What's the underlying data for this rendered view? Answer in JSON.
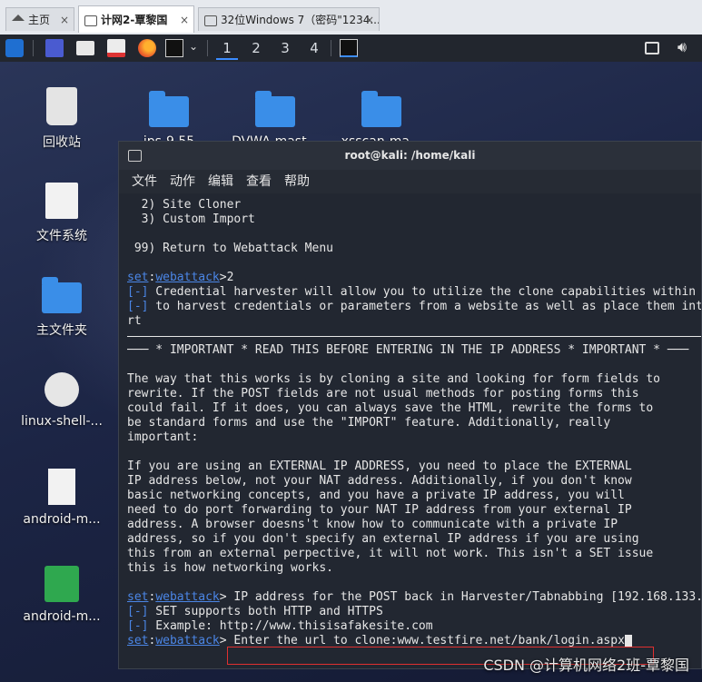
{
  "browser_tabs": [
    {
      "label": "主页",
      "close": "×"
    },
    {
      "label": "计网2-覃黎国",
      "close": "×"
    },
    {
      "label": "32位Windows 7（密码\"1234...",
      "close": "×"
    }
  ],
  "panel": {
    "workspaces": [
      "1",
      "2",
      "3",
      "4"
    ]
  },
  "desktop_icons": [
    {
      "label": "回收站"
    },
    {
      "label": "文件系统"
    },
    {
      "label": "主文件夹"
    },
    {
      "label": "linux-shell-..."
    },
    {
      "label": "android-m..."
    },
    {
      "label": "android-m..."
    },
    {
      "label": "ips-9.55"
    },
    {
      "label": "DVWA-mast..."
    },
    {
      "label": "xsscan-ma..."
    }
  ],
  "terminal": {
    "title": "root@kali: /home/kali",
    "menu": [
      "文件",
      "动作",
      "编辑",
      "查看",
      "帮助"
    ],
    "lines_top": [
      "  2) Site Cloner",
      "  3) Custom Import",
      "",
      " 99) Return to Webattack Menu",
      ""
    ],
    "prompt_set": "set",
    "prompt_module": "webattack",
    "cmd1": ">2",
    "info1_marker": "[-]",
    "info1": " Credential harvester will allow you to utilize the clone capabilities within SET",
    "info2_marker": "[-]",
    "info2": " to harvest credentials or parameters from a website as well as place them into a repo",
    "info2_cont": "rt",
    "important": "─── * IMPORTANT * READ THIS BEFORE ENTERING IN THE IP ADDRESS * IMPORTANT * ───",
    "para1": [
      "The way that this works is by cloning a site and looking for form fields to",
      "rewrite. If the POST fields are not usual methods for posting forms this",
      "could fail. If it does, you can always save the HTML, rewrite the forms to",
      "be standard forms and use the \"IMPORT\" feature. Additionally, really",
      "important:"
    ],
    "para2": [
      "If you are using an EXTERNAL IP ADDRESS, you need to place the EXTERNAL",
      "IP address below, not your NAT address. Additionally, if you don't know",
      "basic networking concepts, and you have a private IP address, you will",
      "need to do port forwarding to your NAT IP address from your external IP",
      "address. A browser doesns't know how to communicate with a private IP",
      "address, so if you don't specify an external IP address if you are using",
      "this from an external perpective, it will not work. This isn't a SET issue",
      "this is how networking works."
    ],
    "cmd2": "> IP address for the POST back in Harvester/Tabnabbing [192.168.133.",
    "info3_marker": "[-]",
    "info3": " SET supports both HTTP and HTTPS",
    "info4_marker": "[-]",
    "info4": " Example: http://www.thisisafakesite.com",
    "cmd3_prefix": "> Enter the url to clone:",
    "cmd3_value": "www.testfire.net/bank/login.aspx"
  },
  "watermark": "CSDN @计算机网络2班-覃黎国"
}
